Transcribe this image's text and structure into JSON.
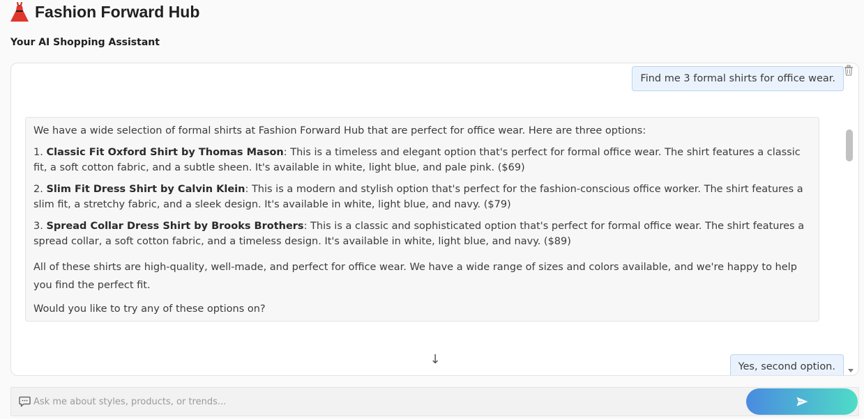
{
  "header": {
    "title": "Fashion Forward Hub",
    "icon": "dress-icon",
    "subtitle": "Your AI Shopping Assistant"
  },
  "chat": {
    "messages": [
      {
        "role": "user",
        "text": "Find me 3 formal shirts for office wear."
      },
      {
        "role": "assistant",
        "intro": "We have a wide selection of formal shirts at Fashion Forward Hub that are perfect for office wear. Here are three options:",
        "options": [
          {
            "number": "1.",
            "name": "Classic Fit Oxford Shirt by Thomas Mason",
            "description": ": This is a timeless and elegant option that's perfect for formal office wear. The shirt features a classic fit, a soft cotton fabric, and a subtle sheen. It's available in white, light blue, and pale pink. ($69)"
          },
          {
            "number": "2.",
            "name": "Slim Fit Dress Shirt by Calvin Klein",
            "description": ": This is a modern and stylish option that's perfect for the fashion-conscious office worker. The shirt features a slim fit, a stretchy fabric, and a sleek design. It's available in white, light blue, and navy. ($79)"
          },
          {
            "number": "3.",
            "name": "Spread Collar Dress Shirt by Brooks Brothers",
            "description": ": This is a classic and sophisticated option that's perfect for formal office wear. The shirt features a spread collar, a soft cotton fabric, and a timeless design. It's available in white, light blue, and navy. ($89)"
          }
        ],
        "summary": "All of these shirts are high-quality, well-made, and perfect for office wear. We have a wide range of sizes and colors available, and we're happy to help you find the perfect fit.",
        "closing": "Would you like to try any of these options on?"
      },
      {
        "role": "user",
        "text": "Yes, second option."
      }
    ],
    "scroll_down_glyph": "↓"
  },
  "input": {
    "placeholder": "Ask me about styles, products, or trends...",
    "value": ""
  },
  "colors": {
    "user_bubble_bg": "#eaf3fd",
    "user_bubble_border": "#b8d4f0",
    "send_gradient_start": "#4a8be0",
    "send_gradient_end": "#4fdcc6"
  }
}
